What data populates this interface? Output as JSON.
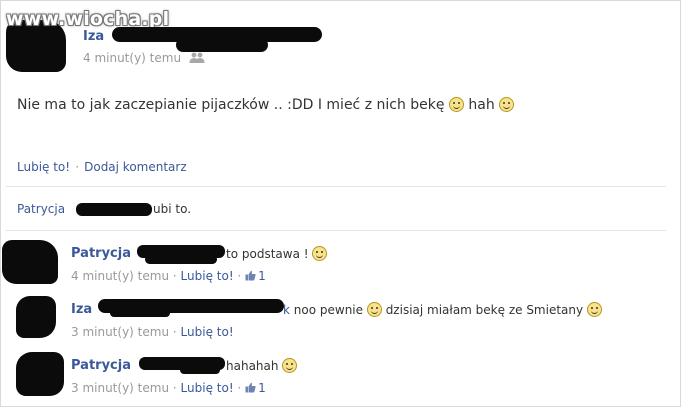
{
  "watermark": "www.wiocha.pl",
  "post": {
    "author": "Iza",
    "time": "4 minut(y) temu",
    "audience_icon": "group-icon",
    "text": "Nie ma to jak zaczepianie pijaczków .. :DD I mieć z nich bekę",
    "text_after_emoji": "hah",
    "actions": {
      "like": "Lubię to!",
      "separator": "·",
      "comment": "Dodaj komentarz"
    }
  },
  "likes": {
    "name": "Patrycja",
    "suffix": "ubi to."
  },
  "comments": [
    {
      "author": "Patrycja",
      "text": "to podstawa !",
      "time": "4 minut(y) temu",
      "like": "Lubię to!",
      "sep": "·",
      "like_count": "1"
    },
    {
      "author": "Iza",
      "text_partial": "k",
      "text": "noo pewnie",
      "text2": "dzisiaj miałam bekę ze Smietany",
      "time": "3 minut(y) temu",
      "like": "Lubię to!",
      "sep": "·"
    },
    {
      "author": "Patrycja",
      "text": "hahahah",
      "time": "3 minut(y) temu",
      "like": "Lubię to!",
      "sep": "·",
      "like_count": "1"
    }
  ],
  "colors": {
    "link": "#3b5998",
    "meta": "#999999",
    "text": "#333333",
    "divider": "#e1e4ea"
  }
}
